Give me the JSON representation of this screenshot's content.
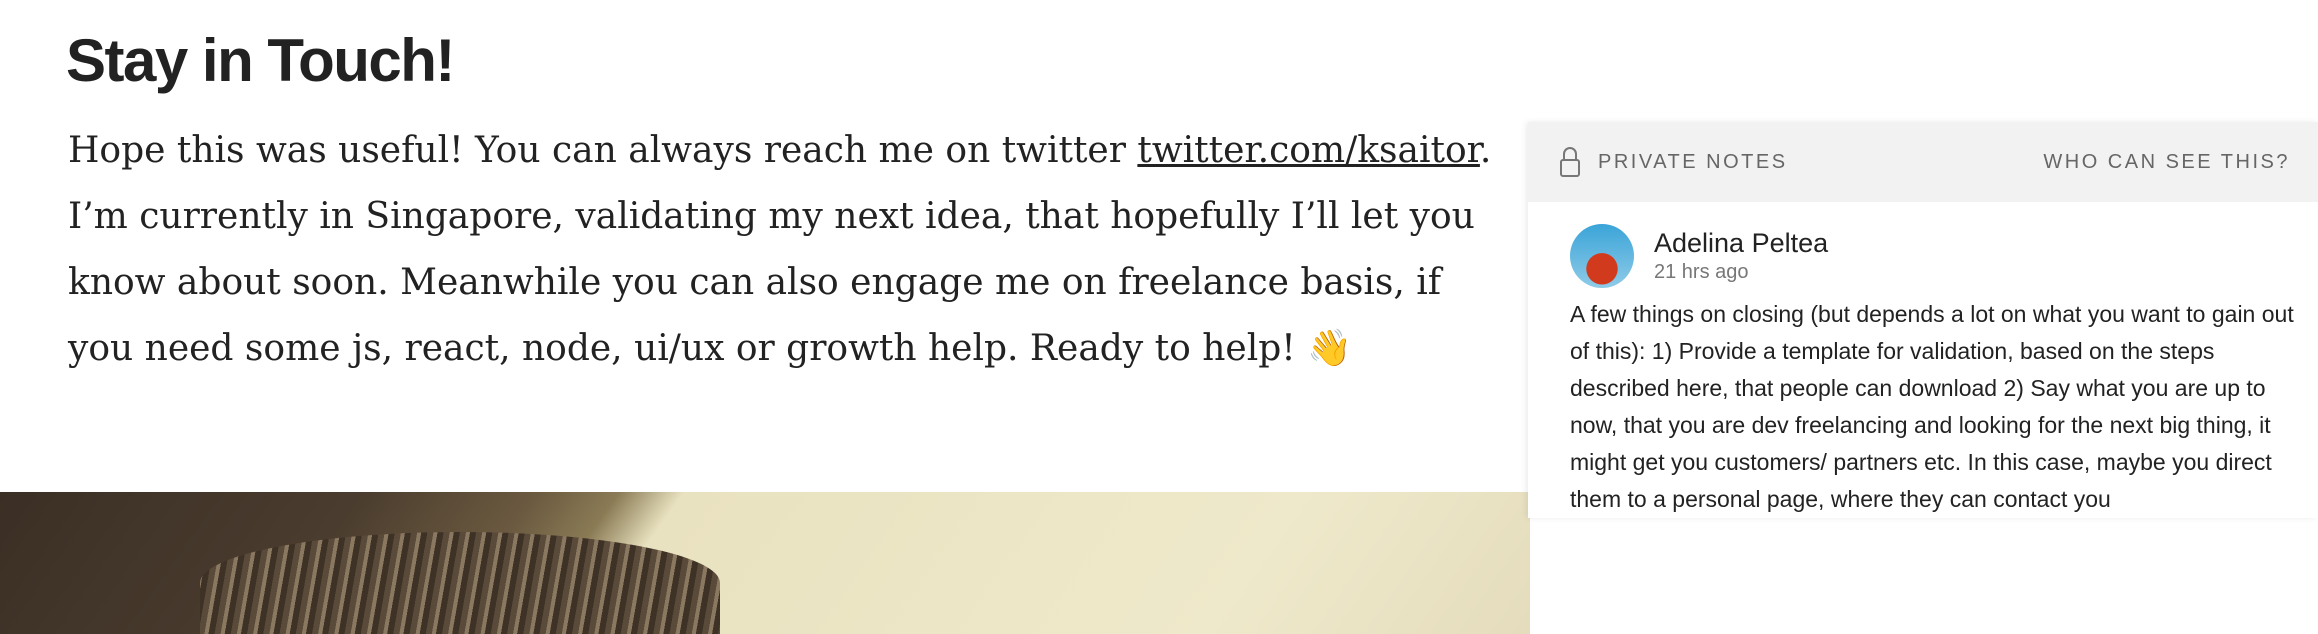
{
  "article": {
    "heading": "Stay in Touch!",
    "text_before_link": "Hope this was useful! You can always reach me on twitter ",
    "link": "twitter.com/ksaitor",
    "text_after_link": ". I’m currently in Singapore, validating my next idea, that hopefully I’ll let you know about soon. Meanwhile you can also engage me on freelance basis, if you need some js, react, node, ui/ux or growth help. Ready to help! 👋"
  },
  "notes_panel": {
    "title": "PRIVATE NOTES",
    "who_can_see": "WHO CAN SEE THIS?",
    "note": {
      "author": "Adelina Peltea",
      "time": "21 hrs ago",
      "text": "A few things on closing (but depends a lot on what you want to gain out of this): 1) Provide a template for validation, based on the steps described here, that people can download 2) Say what you are up to now, that you are dev freelancing and looking for the next big thing, it might get you customers/ partners etc. In this case, maybe you direct them to a personal page, where they can contact you"
    }
  }
}
